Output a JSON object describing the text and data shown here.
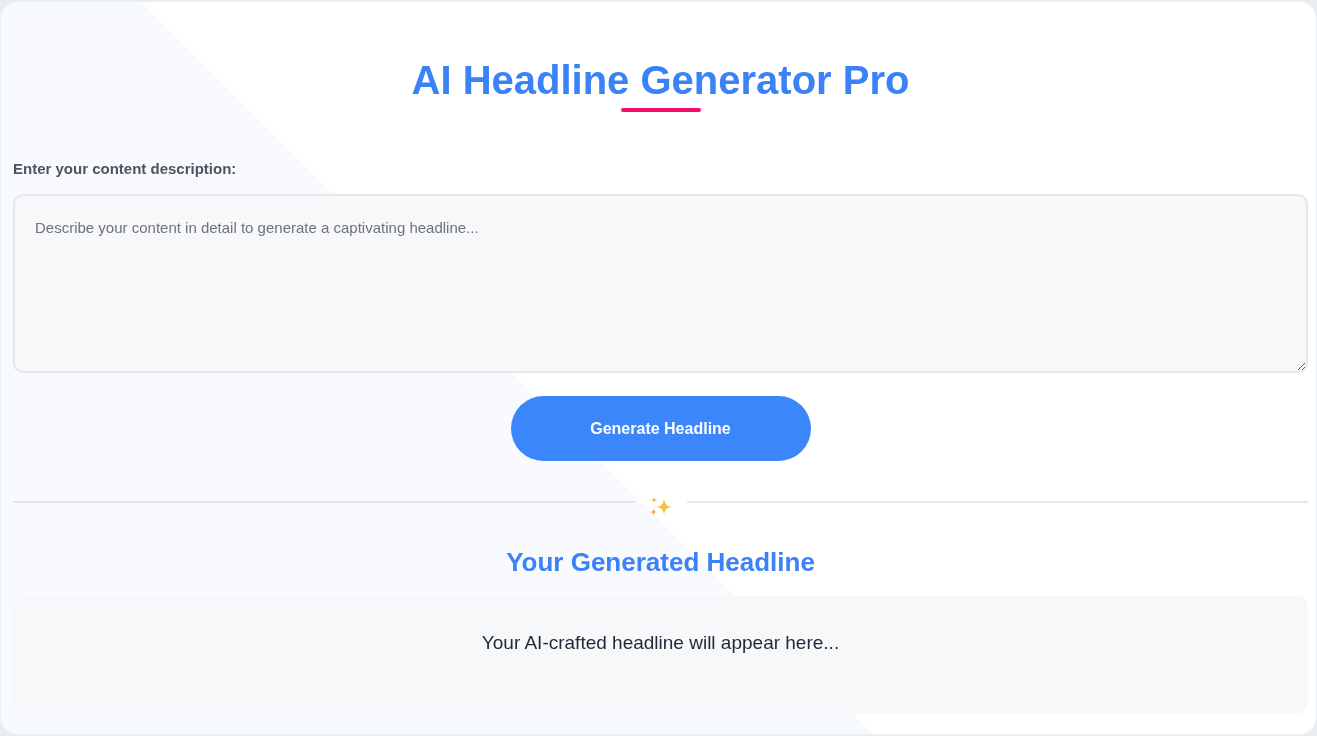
{
  "header": {
    "title": "AI Headline Generator Pro"
  },
  "input": {
    "label": "Enter your content description:",
    "placeholder": "Describe your content in detail to generate a captivating headline..."
  },
  "generate_button": {
    "label": "Generate Headline"
  },
  "result": {
    "heading": "Your Generated Headline",
    "text": "Your AI-crafted headline will appear here..."
  }
}
